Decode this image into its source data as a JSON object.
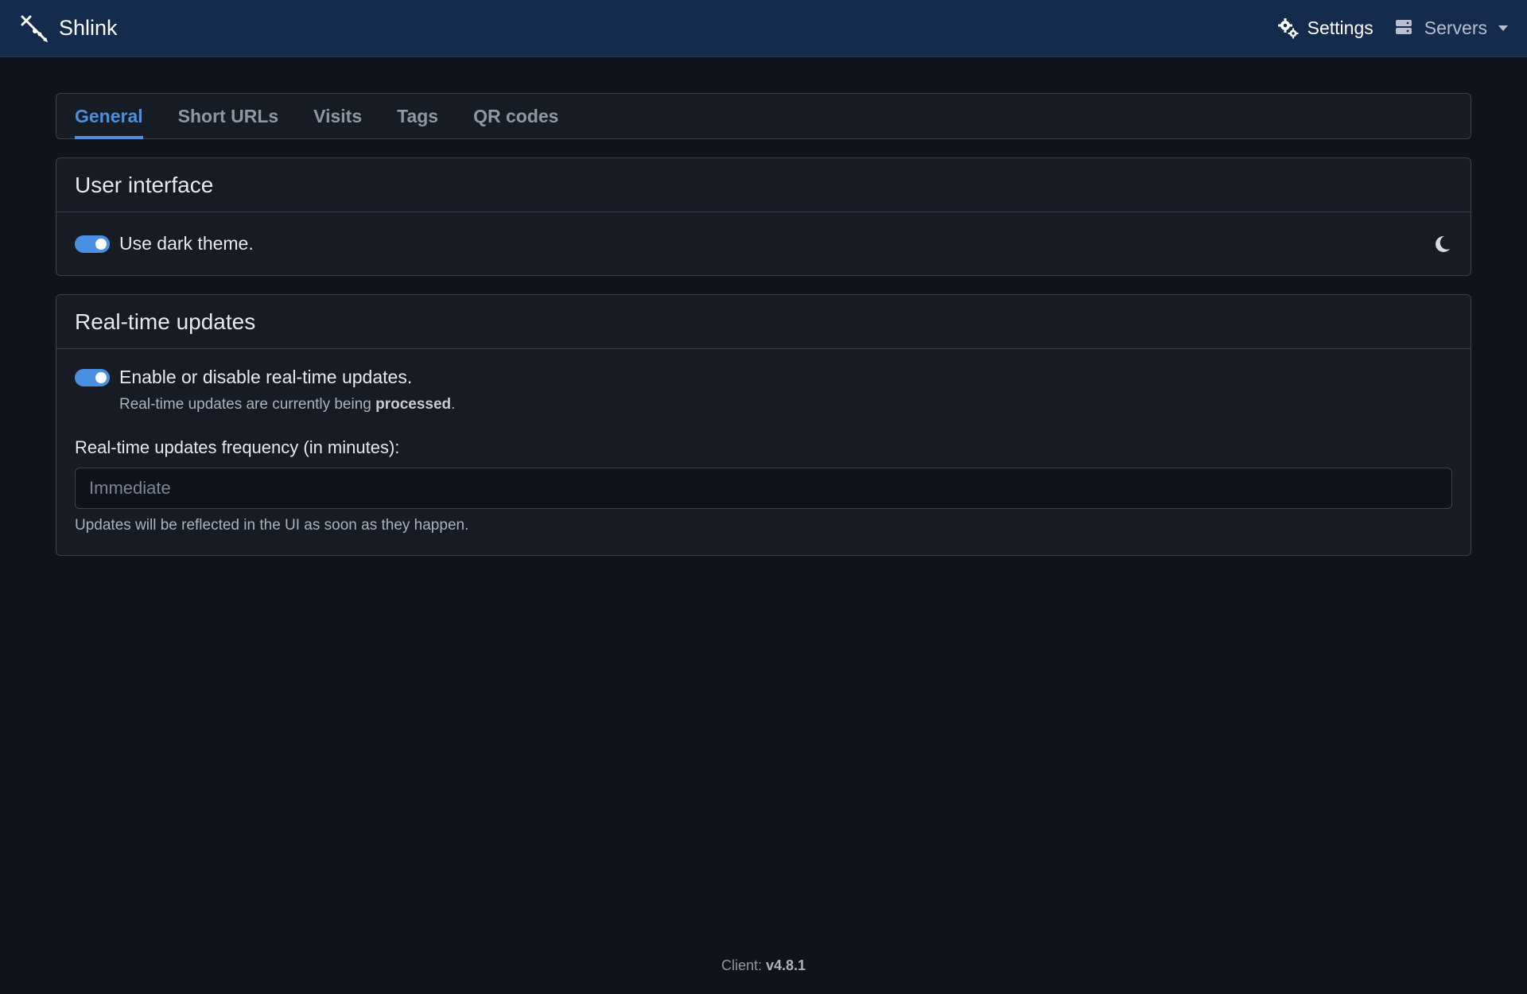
{
  "app": {
    "brand_name": "Shlink",
    "logo_icon": "shlink-logo-icon"
  },
  "nav": {
    "settings_label": "Settings",
    "settings_icon": "gears-icon",
    "servers_label": "Servers",
    "servers_icon": "server-icon"
  },
  "tabs": [
    {
      "label": "General",
      "active": true
    },
    {
      "label": "Short URLs",
      "active": false
    },
    {
      "label": "Visits",
      "active": false
    },
    {
      "label": "Tags",
      "active": false
    },
    {
      "label": "QR codes",
      "active": false
    }
  ],
  "user_interface": {
    "title": "User interface",
    "dark_theme_label": "Use dark theme.",
    "dark_theme_enabled": true,
    "theme_icon": "moon-icon"
  },
  "realtime": {
    "title": "Real-time updates",
    "toggle_label": "Enable or disable real-time updates.",
    "enabled": true,
    "status_prefix": "Real-time updates are currently being ",
    "status_value": "processed",
    "status_suffix": ".",
    "frequency_label": "Real-time updates frequency (in minutes):",
    "frequency_placeholder": "Immediate",
    "frequency_help": "Updates will be reflected in the UI as soon as they happen."
  },
  "footer": {
    "client_label": "Client: ",
    "client_version": "v4.8.1"
  },
  "colors": {
    "navbar_bg": "#152b4d",
    "page_bg": "#10131a",
    "accent": "#4a90e2"
  }
}
